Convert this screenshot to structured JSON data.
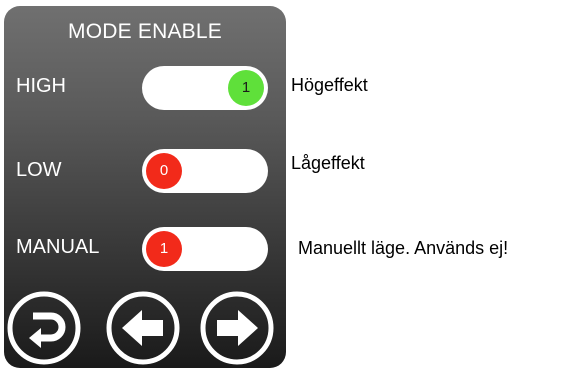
{
  "panel": {
    "title": "MODE ENABLE"
  },
  "modes": [
    {
      "label": "HIGH",
      "value": "1",
      "state": "on",
      "knob_color": "#5fe03a",
      "description": "Högeffekt"
    },
    {
      "label": "LOW",
      "value": "0",
      "state": "off",
      "knob_color": "#f22a1a",
      "description": "Lågeffekt"
    },
    {
      "label": "MANUAL",
      "value": "1",
      "state": "off",
      "knob_color": "#f22a1a",
      "description": "Manuellt läge. Används ej!"
    }
  ],
  "nav": {
    "buttons": [
      {
        "name": "return-icon"
      },
      {
        "name": "arrow-left-icon"
      },
      {
        "name": "arrow-right-icon"
      }
    ]
  },
  "colors": {
    "on": "#5fe03a",
    "off": "#f22a1a",
    "track": "#ffffff"
  }
}
